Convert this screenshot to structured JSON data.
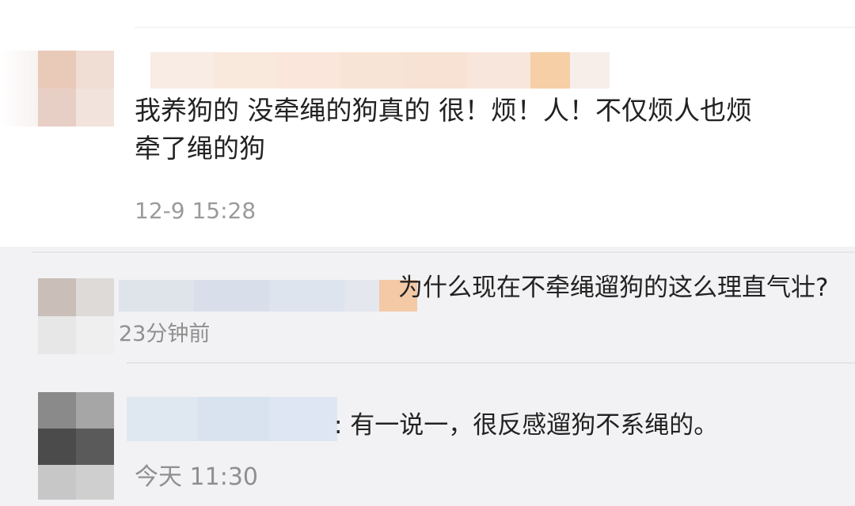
{
  "comment": {
    "text_line1": "我养狗的 没牵绳的狗真的 很！烦！人！不仅烦人也烦",
    "text_line2": "牵了绳的狗",
    "timestamp": "12-9 15:28"
  },
  "replies": [
    {
      "text": "为什么现在不牵绳遛狗的这么理直气壮?",
      "timestamp": "23分钟前"
    },
    {
      "text": ":  有一说一，很反感遛狗不系绳的。",
      "timestamp": "今天 11:30"
    }
  ],
  "mosaic_colors": {
    "avatar_1": [
      "#e9c9b7",
      "#f0ddd4",
      "#e8cfc6",
      "#f3e3dd"
    ],
    "name_1": [
      "#f8ece4",
      "#f9e8dc",
      "#fae6da",
      "#f8e4d6",
      "#f7e2d4",
      "#f8e6dc",
      "#f6cfa6",
      "#f7eee9"
    ],
    "avatar_2": [
      "#c9bfb8",
      "#dddad8",
      "#e7e7e7",
      "#efefef"
    ],
    "name_2": [
      "#dfe3ea",
      "#d8dfeb",
      "#dde4ee",
      "#e4e7ee",
      "#f4c9a6"
    ],
    "avatar_3": [
      "#8a8a8a",
      "#a6a6a6",
      "#4b4b4b",
      "#5a5a5a",
      "#c7c7c7",
      "#cfcfcf"
    ],
    "name_3": [
      "#dfe7f1",
      "#d9e3f0",
      "#dde6f2"
    ]
  }
}
